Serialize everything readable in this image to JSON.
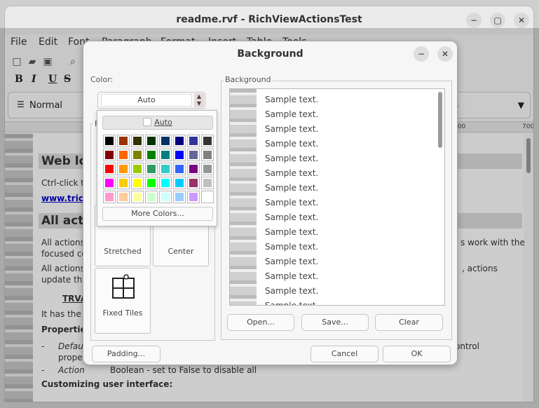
{
  "window": {
    "title": "readme.rvf - RichViewActionsTest",
    "buttons": {
      "minimize": "−",
      "maximize": "▢",
      "close": "✕"
    }
  },
  "menu": [
    "File",
    "Edit",
    "Font",
    "Paragraph",
    "Format",
    "Insert",
    "Table",
    "Tools"
  ],
  "format_buttons": {
    "bold": "B",
    "italic": "I",
    "underline": "U",
    "strike": "S"
  },
  "style_combo": "Normal",
  "ruler": {
    "marks": [
      "500",
      "700"
    ]
  },
  "document": {
    "heading1": "Web lo",
    "line1": "Ctrl-click t",
    "link": "www.trich",
    "heading2": "All acti",
    "para1a": "All actions",
    "para1b": "focused co",
    "para1c": "s work with the",
    "para2a": "All actions",
    "para2b": "update the",
    "para2c": ", actions",
    "trv": "TRVA",
    "ithas": "It has the",
    "properties": "Propertie",
    "dash1": "-",
    "defa": "Defau",
    "prope": "proper",
    "control": "ontrol",
    "dash2": "-",
    "action": "Action",
    "boolean": "Boolean - set to False to disable all",
    "customizing": "Customizing user interface:"
  },
  "dialog": {
    "title": "Background",
    "color_label": "Color:",
    "background_label": "Background",
    "color_value": "Auto",
    "popup": {
      "auto": "Auto",
      "more": "More Colors...",
      "colors": [
        [
          "#000000",
          "#993300",
          "#333300",
          "#003300",
          "#003366",
          "#000080",
          "#333399",
          "#333333"
        ],
        [
          "#800000",
          "#ff6600",
          "#808000",
          "#008000",
          "#008080",
          "#0000ff",
          "#666699",
          "#808080"
        ],
        [
          "#ff0000",
          "#ff9900",
          "#99cc00",
          "#339966",
          "#33cccc",
          "#3366ff",
          "#800080",
          "#969696"
        ],
        [
          "#ff00ff",
          "#ffcc00",
          "#ffff00",
          "#00ff00",
          "#00ffff",
          "#00ccff",
          "#993366",
          "#c0c0c0"
        ],
        [
          "#ff99cc",
          "#ffcc99",
          "#ffff99",
          "#ccffcc",
          "#ccffff",
          "#99ccff",
          "#cc99ff",
          "#ffffff"
        ]
      ]
    },
    "tiles": {
      "stretched": "Stretched",
      "center": "Center",
      "fixed_tiles": "Fixed Tiles"
    },
    "sample_text": "Sample text.",
    "buttons": {
      "open": "Open...",
      "save": "Save...",
      "clear": "Clear",
      "padding": "Padding...",
      "cancel": "Cancel",
      "ok": "OK"
    }
  }
}
